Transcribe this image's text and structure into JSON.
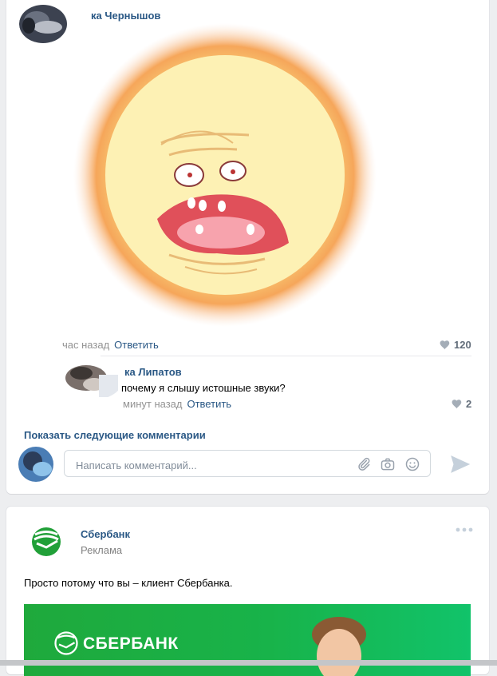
{
  "post1": {
    "author": "Гриша Чернышов",
    "author_visible": "ка Чернышов",
    "comment_time": "час назад",
    "reply_label": "Ответить",
    "likes": "120"
  },
  "reply": {
    "author_visible": "ка Липатов",
    "text": "почему я слышу истошные звуки?",
    "time": "минут назад",
    "reply_label": "Ответить",
    "likes": "2"
  },
  "show_more": "Показать следующие комментарии",
  "comment_box": {
    "placeholder": "Написать комментарий..."
  },
  "ad": {
    "brand": "Сбербанк",
    "label": "Реклама",
    "text": "Просто потому что вы – клиент Сбербанка.",
    "banner_brand": "СБЕРБАНК"
  },
  "colors": {
    "link": "#2a5885",
    "sber_green": "#21a038",
    "muted": "#939393"
  },
  "icons": [
    "heart-icon",
    "paperclip-icon",
    "camera-icon",
    "smile-icon",
    "send-icon",
    "more-dots-icon",
    "sberbank-logo"
  ]
}
